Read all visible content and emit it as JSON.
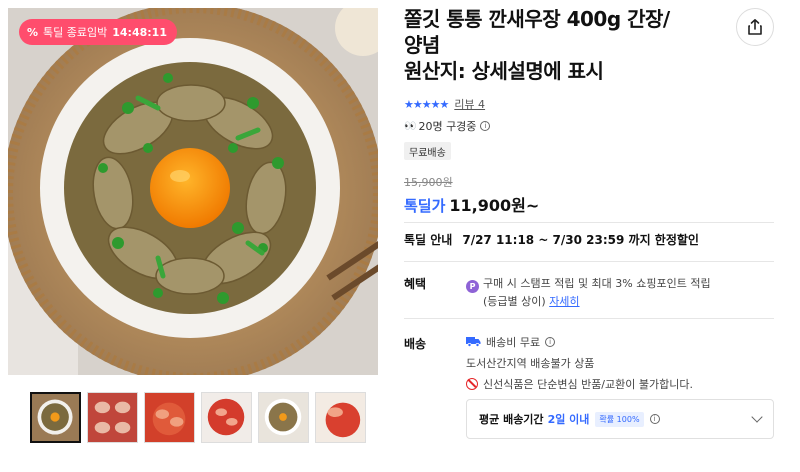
{
  "gallery": {
    "timer_badge": {
      "icon": "percent-icon",
      "label": "톡딜 종료임박",
      "time": "14:48:11"
    },
    "thumbnails": [
      "thumb-1",
      "thumb-2",
      "thumb-3",
      "thumb-4",
      "thumb-5",
      "thumb-6"
    ]
  },
  "product": {
    "title_lines": [
      "쫄깃 통통 깐새우장 400g 간장/",
      "양념",
      "원산지: 상세설명에 표시"
    ],
    "share_icon": "share-icon",
    "rating": {
      "stars": 5,
      "review_label": "리뷰 4"
    },
    "viewers": "20명 구경중",
    "free_shipping_tag": "무료배송",
    "original_price": "15,900원",
    "price_prefix": "톡딜가",
    "price": "11,900원~",
    "deal": {
      "label": "톡딜 안내",
      "period": "7/27 11:18 ~ 7/30 23:59 까지 한정할인"
    }
  },
  "benefit": {
    "label": "혜택",
    "line1": "구매 시 스탬프 적립 및 최대 3% 쇼핑포인트 적립",
    "line2_prefix": "(등급별 상이)",
    "detail_link": "자세히"
  },
  "shipping": {
    "label": "배송",
    "fee": "배송비 무료",
    "restriction": "도서산간지역 배송불가 상품",
    "notice": "신선식품은 단순변심 반품/교환이 불가합니다.",
    "avg_label": "평균 배송기간",
    "avg_value": "2일 이내",
    "probability": "확률 100%"
  },
  "colors": {
    "accent": "#346aff",
    "badge": "#ff4d6d",
    "point": "#8e63d6",
    "warning": "#e52528"
  }
}
